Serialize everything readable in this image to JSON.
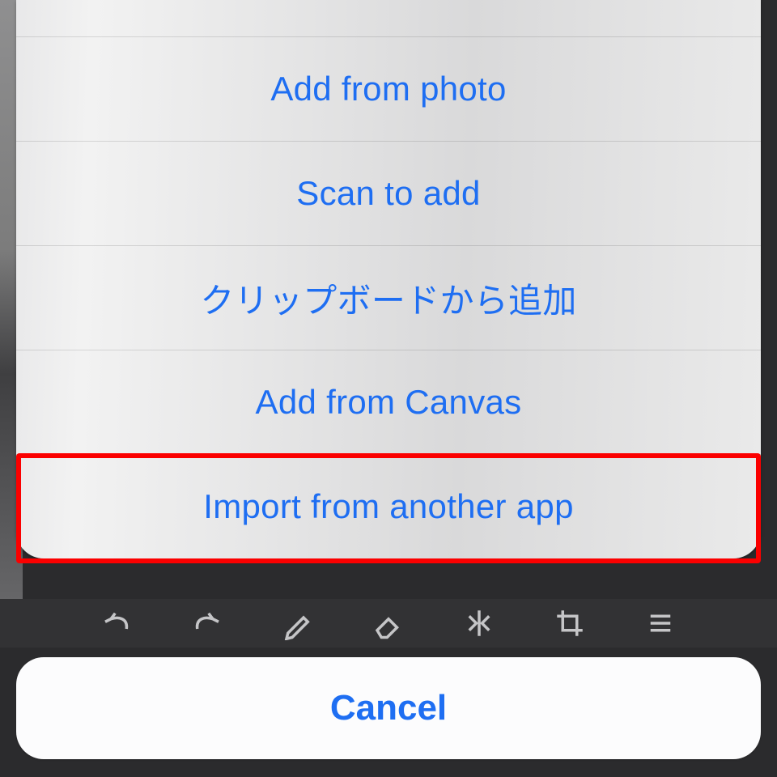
{
  "actionSheet": {
    "options": [
      {
        "label": ""
      },
      {
        "label": "Add from photo"
      },
      {
        "label": "Scan to add"
      },
      {
        "label": "クリップボードから追加"
      },
      {
        "label": "Add from Canvas"
      },
      {
        "label": "Import from another app"
      }
    ],
    "highlightIndex": 5,
    "cancel": "Cancel"
  },
  "toolbarIcons": [
    "undo",
    "redo",
    "pen",
    "eraser",
    "flip",
    "crop",
    "menu"
  ]
}
